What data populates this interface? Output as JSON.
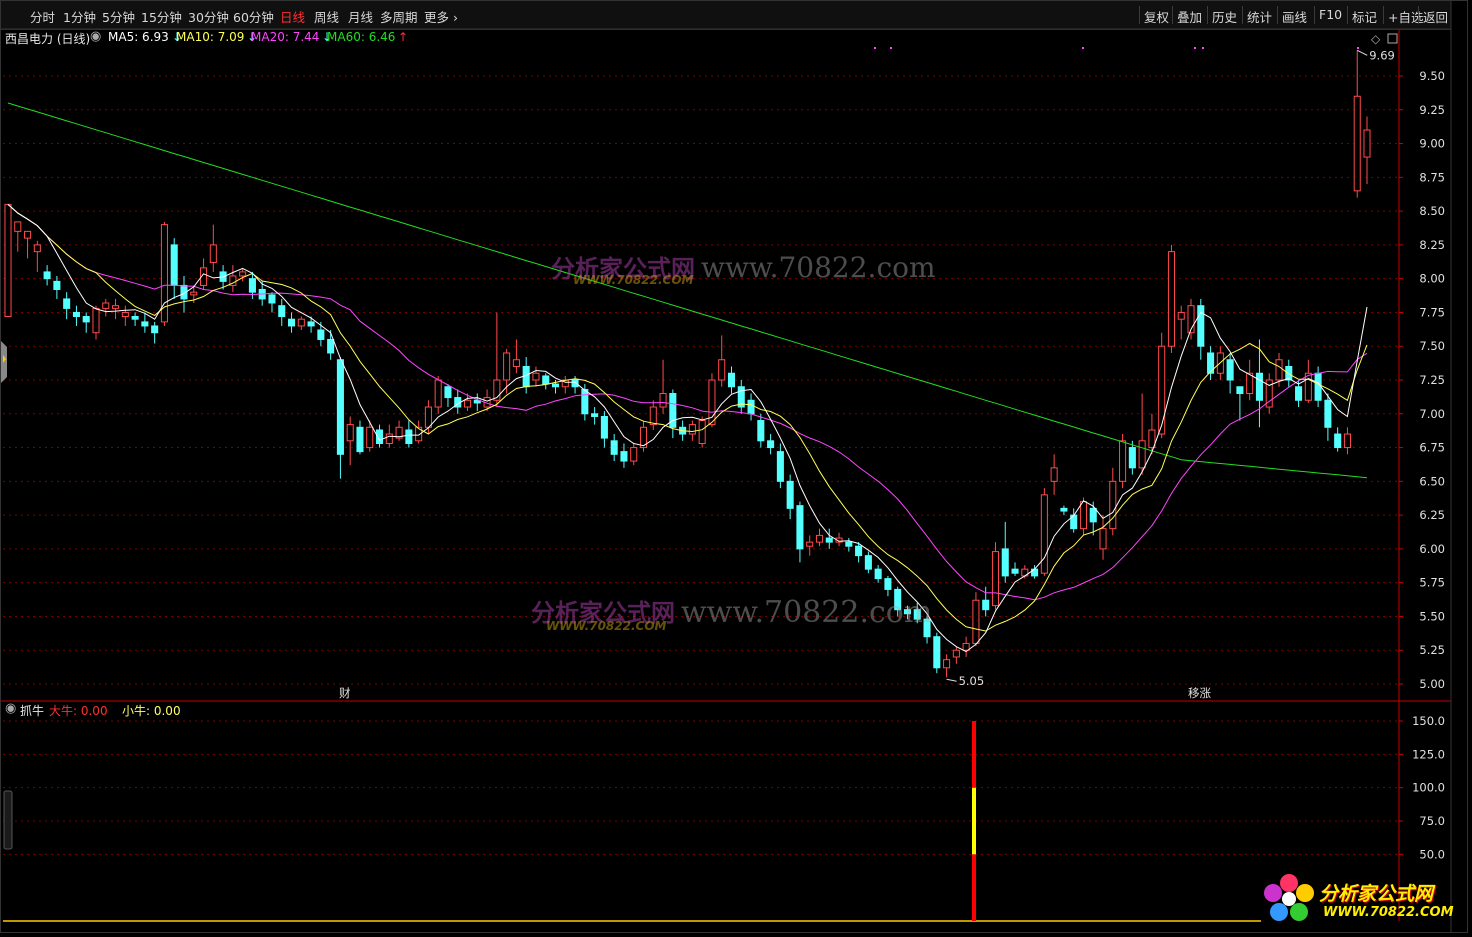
{
  "toolbar": {
    "left_tabs": [
      "分时",
      "1分钟",
      "5分钟",
      "15分钟",
      "30分钟",
      "60分钟",
      "日线",
      "周线",
      "月线",
      "多周期",
      "更多"
    ],
    "active_tab": "日线",
    "right_tabs": [
      "复权",
      "叠加",
      "历史",
      "统计",
      "画线",
      "F10",
      "标记",
      "+自选",
      "返回"
    ]
  },
  "main_chart": {
    "stock_name": "西昌电力 (日线)",
    "ma": [
      {
        "label": "MA5: 6.93",
        "arrow": "↓",
        "color": "#ffffff"
      },
      {
        "label": "MA10: 7.09",
        "arrow": "↓",
        "color": "#ffff55"
      },
      {
        "label": "MA20: 7.44",
        "arrow": "↓",
        "color": "#ff44ff"
      },
      {
        "label": "MA60: 6.46",
        "arrow": "↑",
        "color": "#22dd22"
      }
    ],
    "price_axis": [
      "9.50",
      "9.25",
      "9.00",
      "8.75",
      "8.50",
      "8.25",
      "8.00",
      "7.75",
      "7.50",
      "7.25",
      "7.00",
      "6.75",
      "6.50",
      "6.25",
      "6.00",
      "5.75",
      "5.50",
      "5.25",
      "5.00"
    ],
    "high_label": "9.69",
    "low_label": "5.05",
    "markers": [
      "财",
      "移涨"
    ]
  },
  "sub_chart": {
    "name": "抓牛",
    "big_bull": "大牛: 0.00",
    "small_bull": "小牛: 0.00",
    "axis": [
      "150.0",
      "125.0",
      "100.0",
      "75.0",
      "50.0"
    ]
  },
  "watermarks": {
    "url": "www.70822.com",
    "cn": "分析家公式网",
    "small_url": "WWW.70822.COM"
  },
  "logo": {
    "cn": "分析家公式网",
    "url": "WWW.70822.COM"
  },
  "chart_data": {
    "type": "candlestick",
    "title": "西昌电力 (日线)",
    "ylim": [
      5.0,
      9.5
    ],
    "colors": {
      "up": "#ff4a4a",
      "down": "#54ffff",
      "ma5": "#ffffff",
      "ma10": "#ffff55",
      "ma20": "#ff44ff",
      "ma60": "#22dd22"
    },
    "candles": [
      [
        7.72,
        8.55,
        8.55,
        8.15
      ],
      [
        8.35,
        8.42,
        8.42,
        8.2
      ],
      [
        8.3,
        8.35,
        8.35,
        8.15
      ],
      [
        8.2,
        8.25,
        8.28,
        8.05
      ],
      [
        8.05,
        8.0,
        8.1,
        7.95
      ],
      [
        7.98,
        7.92,
        8.02,
        7.85
      ],
      [
        7.85,
        7.78,
        7.9,
        7.7
      ],
      [
        7.75,
        7.72,
        7.8,
        7.65
      ],
      [
        7.72,
        7.68,
        7.75,
        7.6
      ],
      [
        7.6,
        7.78,
        7.8,
        7.55
      ],
      [
        7.78,
        7.82,
        7.85,
        7.72
      ],
      [
        7.78,
        7.8,
        7.85,
        7.7
      ],
      [
        7.72,
        7.75,
        7.8,
        7.65
      ],
      [
        7.72,
        7.7,
        7.75,
        7.65
      ],
      [
        7.68,
        7.65,
        7.75,
        7.6
      ],
      [
        7.65,
        7.6,
        7.68,
        7.52
      ],
      [
        7.68,
        8.4,
        8.42,
        7.65
      ],
      [
        8.25,
        7.95,
        8.3,
        7.85
      ],
      [
        7.95,
        7.85,
        8.02,
        7.75
      ],
      [
        7.88,
        7.9,
        7.95,
        7.82
      ],
      [
        7.95,
        8.08,
        8.15,
        7.92
      ],
      [
        8.12,
        8.25,
        8.4,
        8.05
      ],
      [
        8.05,
        7.98,
        8.1,
        7.92
      ],
      [
        7.95,
        8.02,
        8.1,
        7.9
      ],
      [
        8.02,
        8.05,
        8.08,
        7.98
      ],
      [
        8.0,
        7.9,
        8.05,
        7.85
      ],
      [
        7.92,
        7.85,
        7.98,
        7.8
      ],
      [
        7.88,
        7.82,
        7.9,
        7.75
      ],
      [
        7.8,
        7.72,
        7.85,
        7.65
      ],
      [
        7.7,
        7.65,
        7.75,
        7.6
      ],
      [
        7.65,
        7.7,
        7.72,
        7.62
      ],
      [
        7.68,
        7.65,
        7.72,
        7.6
      ],
      [
        7.62,
        7.55,
        7.68,
        7.5
      ],
      [
        7.55,
        7.45,
        7.62,
        7.4
      ],
      [
        7.4,
        6.7,
        7.42,
        6.52
      ],
      [
        6.8,
        6.92,
        6.98,
        6.62
      ],
      [
        6.9,
        6.72,
        6.95,
        6.7
      ],
      [
        6.75,
        6.9,
        6.95,
        6.72
      ],
      [
        6.88,
        6.78,
        6.92,
        6.75
      ],
      [
        6.78,
        6.85,
        6.92,
        6.75
      ],
      [
        6.82,
        6.9,
        6.95,
        6.8
      ],
      [
        6.88,
        6.78,
        6.95,
        6.75
      ],
      [
        6.8,
        6.9,
        6.95,
        6.78
      ],
      [
        6.9,
        7.05,
        7.1,
        6.85
      ],
      [
        7.05,
        7.25,
        7.28,
        7.0
      ],
      [
        7.2,
        7.12,
        7.22,
        7.05
      ],
      [
        7.12,
        7.05,
        7.18,
        7.0
      ],
      [
        7.05,
        7.1,
        7.15,
        7.02
      ],
      [
        7.1,
        7.08,
        7.15,
        7.02
      ],
      [
        7.05,
        7.12,
        7.18,
        7.02
      ],
      [
        7.1,
        7.25,
        7.75,
        7.05
      ],
      [
        7.25,
        7.45,
        7.48,
        7.15
      ],
      [
        7.35,
        7.4,
        7.55,
        7.3
      ],
      [
        7.35,
        7.2,
        7.42,
        7.15
      ],
      [
        7.25,
        7.3,
        7.35,
        7.2
      ],
      [
        7.28,
        7.22,
        7.3,
        7.18
      ],
      [
        7.22,
        7.2,
        7.25,
        7.15
      ],
      [
        7.2,
        7.25,
        7.28,
        7.15
      ],
      [
        7.25,
        7.2,
        7.28,
        7.15
      ],
      [
        7.18,
        7.0,
        7.22,
        6.95
      ],
      [
        7.0,
        6.98,
        7.05,
        6.92
      ],
      [
        6.98,
        6.82,
        7.02,
        6.75
      ],
      [
        6.8,
        6.7,
        6.85,
        6.65
      ],
      [
        6.72,
        6.65,
        6.78,
        6.6
      ],
      [
        6.65,
        6.75,
        6.78,
        6.62
      ],
      [
        6.75,
        6.9,
        6.95,
        6.72
      ],
      [
        6.92,
        7.05,
        7.1,
        6.88
      ],
      [
        7.05,
        7.15,
        7.4,
        7.0
      ],
      [
        7.15,
        6.9,
        7.18,
        6.82
      ],
      [
        6.9,
        6.85,
        6.95,
        6.8
      ],
      [
        6.85,
        6.92,
        6.95,
        6.8
      ],
      [
        6.78,
        6.95,
        6.98,
        6.75
      ],
      [
        6.92,
        7.25,
        7.3,
        6.9
      ],
      [
        7.25,
        7.4,
        7.58,
        7.2
      ],
      [
        7.3,
        7.2,
        7.35,
        7.15
      ],
      [
        7.2,
        7.05,
        7.25,
        7.0
      ],
      [
        7.1,
        7.0,
        7.15,
        6.95
      ],
      [
        6.95,
        6.8,
        7.0,
        6.75
      ],
      [
        6.8,
        6.75,
        6.85,
        6.7
      ],
      [
        6.72,
        6.5,
        6.78,
        6.45
      ],
      [
        6.5,
        6.3,
        6.55,
        6.22
      ],
      [
        6.32,
        6.0,
        6.35,
        5.9
      ],
      [
        6.02,
        6.05,
        6.1,
        5.95
      ],
      [
        6.05,
        6.1,
        6.15,
        6.02
      ],
      [
        6.08,
        6.05,
        6.15,
        6.0
      ],
      [
        6.05,
        6.08,
        6.12,
        6.02
      ],
      [
        6.05,
        6.02,
        6.08,
        5.98
      ],
      [
        6.02,
        5.95,
        6.05,
        5.9
      ],
      [
        5.95,
        5.85,
        5.98,
        5.82
      ],
      [
        5.85,
        5.78,
        5.88,
        5.75
      ],
      [
        5.78,
        5.7,
        5.8,
        5.65
      ],
      [
        5.7,
        5.55,
        5.72,
        5.5
      ],
      [
        5.55,
        5.52,
        5.58,
        5.48
      ],
      [
        5.55,
        5.48,
        5.6,
        5.45
      ],
      [
        5.48,
        5.35,
        5.5,
        5.3
      ],
      [
        5.35,
        5.12,
        5.38,
        5.08
      ],
      [
        5.12,
        5.18,
        5.22,
        5.05
      ],
      [
        5.2,
        5.25,
        5.28,
        5.15
      ],
      [
        5.25,
        5.3,
        5.35,
        5.2
      ],
      [
        5.3,
        5.62,
        5.68,
        5.28
      ],
      [
        5.62,
        5.55,
        5.72,
        5.5
      ],
      [
        5.58,
        5.98,
        6.05,
        5.55
      ],
      [
        6.0,
        5.8,
        6.2,
        5.75
      ],
      [
        5.85,
        5.82,
        5.9,
        5.8
      ],
      [
        5.8,
        5.85,
        5.88,
        5.78
      ],
      [
        5.85,
        5.8,
        5.88,
        5.78
      ],
      [
        5.82,
        6.4,
        6.45,
        5.8
      ],
      [
        6.5,
        6.6,
        6.7,
        6.4
      ],
      [
        6.3,
        6.28,
        6.32,
        6.25
      ],
      [
        6.25,
        6.15,
        6.3,
        6.12
      ],
      [
        6.15,
        6.35,
        6.38,
        6.1
      ],
      [
        6.3,
        6.2,
        6.35,
        6.1
      ],
      [
        6.0,
        6.15,
        6.25,
        5.92
      ],
      [
        6.15,
        6.5,
        6.6,
        6.1
      ],
      [
        6.5,
        6.8,
        6.85,
        6.45
      ],
      [
        6.75,
        6.6,
        6.8,
        6.55
      ],
      [
        6.6,
        6.8,
        7.15,
        6.55
      ],
      [
        6.75,
        6.88,
        7.0,
        6.7
      ],
      [
        6.85,
        7.5,
        7.6,
        6.82
      ],
      [
        7.5,
        8.2,
        8.25,
        7.45
      ],
      [
        7.7,
        7.75,
        7.8,
        7.55
      ],
      [
        7.6,
        7.8,
        7.85,
        7.55
      ],
      [
        7.8,
        7.5,
        7.85,
        7.4
      ],
      [
        7.45,
        7.3,
        7.5,
        7.25
      ],
      [
        7.3,
        7.45,
        7.5,
        7.25
      ],
      [
        7.4,
        7.25,
        7.45,
        7.15
      ],
      [
        7.2,
        7.15,
        7.2,
        6.95
      ],
      [
        7.15,
        7.3,
        7.4,
        7.1
      ],
      [
        7.3,
        7.1,
        7.55,
        6.9
      ],
      [
        7.05,
        7.25,
        7.3,
        7.0
      ],
      [
        7.25,
        7.4,
        7.45,
        7.2
      ],
      [
        7.35,
        7.25,
        7.4,
        7.2
      ],
      [
        7.2,
        7.1,
        7.25,
        7.05
      ],
      [
        7.1,
        7.3,
        7.4,
        7.08
      ],
      [
        7.3,
        7.1,
        7.35,
        7.05
      ],
      [
        7.1,
        6.9,
        7.15,
        6.8
      ],
      [
        6.85,
        6.75,
        6.9,
        6.72
      ],
      [
        6.75,
        6.85,
        6.9,
        6.7
      ],
      [
        8.65,
        9.35,
        9.69,
        8.6
      ],
      [
        8.9,
        9.1,
        9.2,
        8.7
      ]
    ],
    "sub_bar": {
      "x_index": 94,
      "segments": [
        {
          "from": 0,
          "to": 50,
          "color": "#ff0000"
        },
        {
          "from": 50,
          "to": 100,
          "color": "#ffff00"
        },
        {
          "from": 100,
          "to": 150,
          "color": "#ff0000"
        }
      ]
    }
  }
}
